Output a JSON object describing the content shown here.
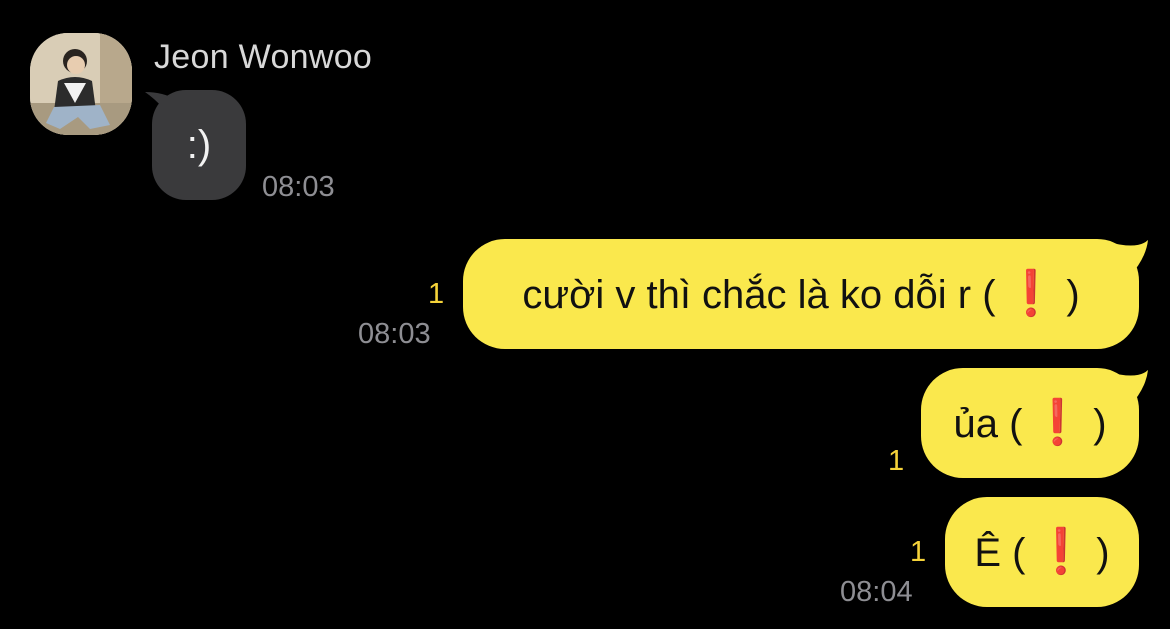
{
  "chat": {
    "incoming": {
      "sender_name": "Jeon Wonwoo",
      "avatar_icon": "profile-photo",
      "messages": [
        {
          "text": ":)",
          "time": "08:03"
        }
      ]
    },
    "outgoing": [
      {
        "pre": "cười v thì chắc là ko dỗi r (",
        "emoji": "❗",
        "post": ")",
        "unread_count": "1",
        "time": "08:03"
      },
      {
        "pre": "ủa (",
        "emoji": "❗",
        "post": ")",
        "unread_count": "1",
        "time": ""
      },
      {
        "pre": "Ê (",
        "emoji": "❗",
        "post": ")",
        "unread_count": "1",
        "time": "08:04"
      }
    ],
    "colors": {
      "outgoing_bubble": "#fae84d",
      "incoming_bubble": "#3a3a3c",
      "unread": "#f5d33a",
      "background": "#000000"
    }
  }
}
